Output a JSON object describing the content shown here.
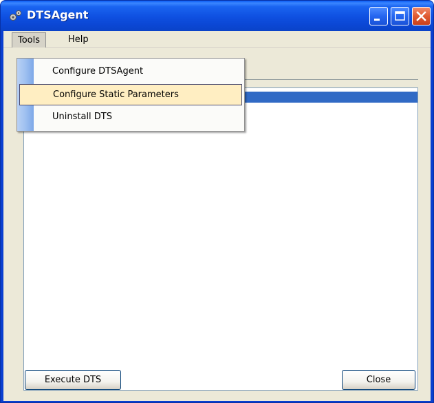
{
  "window": {
    "title": "DTSAgent",
    "icon": "gear-pair-icon",
    "controls": [
      "minimize-icon",
      "maximize-icon",
      "close-icon"
    ]
  },
  "menubar": {
    "items": [
      {
        "label": "Tools",
        "open": true
      },
      {
        "label": "Help",
        "open": false
      }
    ]
  },
  "dropdown": {
    "items": [
      {
        "label": "Configure DTSAgent",
        "highlighted": false
      },
      {
        "label": "Configure Static Parameters",
        "highlighted": true
      },
      {
        "label": "Uninstall DTS",
        "highlighted": false
      }
    ]
  },
  "buttons": {
    "execute_label": "Execute DTS",
    "close_label": "Close"
  },
  "colors": {
    "titlebar": "#0a5df5",
    "client_bg": "#ece9d8",
    "selection": "#316ac5",
    "menu_highlight": "#ffeec2"
  }
}
